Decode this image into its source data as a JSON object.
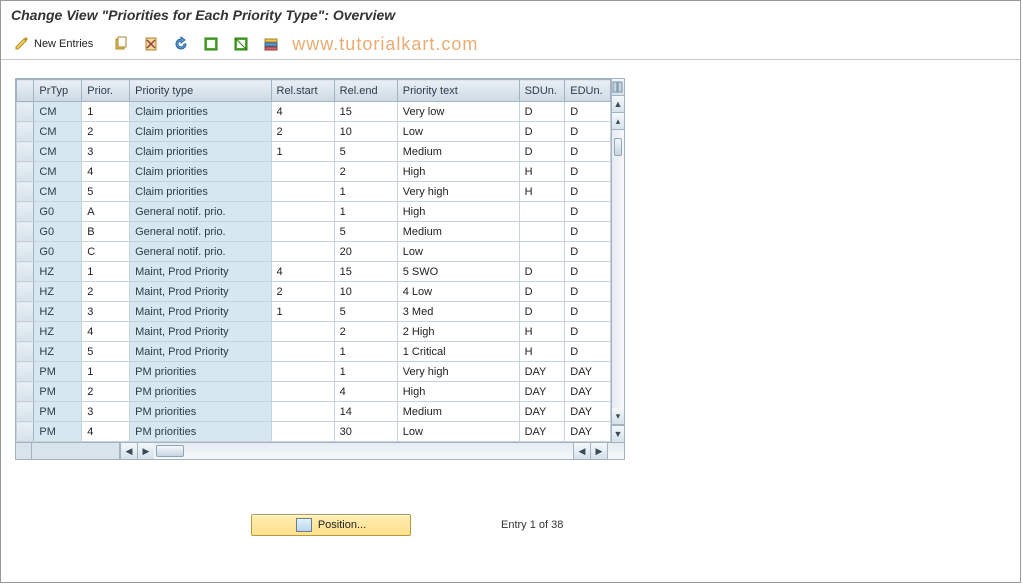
{
  "title": "Change View \"Priorities for Each Priority Type\": Overview",
  "watermark": "www.tutorialkart.com",
  "toolbar": {
    "new_entries_label": "New Entries"
  },
  "columns": {
    "prtyp": "PrTyp",
    "prior": "Prior.",
    "ptype": "Priority type",
    "start": "Rel.start",
    "end": "Rel.end",
    "ptext": "Priority text",
    "sd": "SDUn.",
    "ed": "EDUn."
  },
  "rows": [
    {
      "prtyp": "CM",
      "prior": "1",
      "ptype": "Claim priorities",
      "start": "4",
      "end": "15",
      "ptext": "Very low",
      "sd": "D",
      "ed": "D"
    },
    {
      "prtyp": "CM",
      "prior": "2",
      "ptype": "Claim priorities",
      "start": "2",
      "end": "10",
      "ptext": "Low",
      "sd": "D",
      "ed": "D"
    },
    {
      "prtyp": "CM",
      "prior": "3",
      "ptype": "Claim priorities",
      "start": "1",
      "end": "5",
      "ptext": "Medium",
      "sd": "D",
      "ed": "D"
    },
    {
      "prtyp": "CM",
      "prior": "4",
      "ptype": "Claim priorities",
      "start": "",
      "end": "2",
      "ptext": "High",
      "sd": "H",
      "ed": "D"
    },
    {
      "prtyp": "CM",
      "prior": "5",
      "ptype": "Claim priorities",
      "start": "",
      "end": "1",
      "ptext": "Very high",
      "sd": "H",
      "ed": "D"
    },
    {
      "prtyp": "G0",
      "prior": "A",
      "ptype": "General notif. prio.",
      "start": "",
      "end": "1",
      "ptext": "High",
      "sd": "",
      "ed": "D"
    },
    {
      "prtyp": "G0",
      "prior": "B",
      "ptype": "General notif. prio.",
      "start": "",
      "end": "5",
      "ptext": "Medium",
      "sd": "",
      "ed": "D"
    },
    {
      "prtyp": "G0",
      "prior": "C",
      "ptype": "General notif. prio.",
      "start": "",
      "end": "20",
      "ptext": "Low",
      "sd": "",
      "ed": "D"
    },
    {
      "prtyp": "HZ",
      "prior": "1",
      "ptype": "Maint, Prod Priority",
      "start": "4",
      "end": "15",
      "ptext": "5 SWO",
      "sd": "D",
      "ed": "D"
    },
    {
      "prtyp": "HZ",
      "prior": "2",
      "ptype": "Maint, Prod Priority",
      "start": "2",
      "end": "10",
      "ptext": "4 Low",
      "sd": "D",
      "ed": "D"
    },
    {
      "prtyp": "HZ",
      "prior": "3",
      "ptype": "Maint, Prod Priority",
      "start": "1",
      "end": "5",
      "ptext": "3 Med",
      "sd": "D",
      "ed": "D"
    },
    {
      "prtyp": "HZ",
      "prior": "4",
      "ptype": "Maint, Prod Priority",
      "start": "",
      "end": "2",
      "ptext": "2 High",
      "sd": "H",
      "ed": "D"
    },
    {
      "prtyp": "HZ",
      "prior": "5",
      "ptype": "Maint, Prod Priority",
      "start": "",
      "end": "1",
      "ptext": "1 Critical",
      "sd": "H",
      "ed": "D"
    },
    {
      "prtyp": "PM",
      "prior": "1",
      "ptype": "PM priorities",
      "start": "",
      "end": "1",
      "ptext": "Very high",
      "sd": "DAY",
      "ed": "DAY"
    },
    {
      "prtyp": "PM",
      "prior": "2",
      "ptype": "PM priorities",
      "start": "",
      "end": "4",
      "ptext": "High",
      "sd": "DAY",
      "ed": "DAY"
    },
    {
      "prtyp": "PM",
      "prior": "3",
      "ptype": "PM priorities",
      "start": "",
      "end": "14",
      "ptext": "Medium",
      "sd": "DAY",
      "ed": "DAY"
    },
    {
      "prtyp": "PM",
      "prior": "4",
      "ptype": "PM priorities",
      "start": "",
      "end": "30",
      "ptext": "Low",
      "sd": "DAY",
      "ed": "DAY"
    }
  ],
  "footer": {
    "position_label": "Position...",
    "status": "Entry 1 of 38"
  },
  "chart_data": {
    "type": "table",
    "title": "Priorities for Each Priority Type",
    "columns": [
      "PrTyp",
      "Prior.",
      "Priority type",
      "Rel.start",
      "Rel.end",
      "Priority text",
      "SDUn.",
      "EDUn."
    ],
    "rows": [
      [
        "CM",
        "1",
        "Claim priorities",
        "4",
        "15",
        "Very low",
        "D",
        "D"
      ],
      [
        "CM",
        "2",
        "Claim priorities",
        "2",
        "10",
        "Low",
        "D",
        "D"
      ],
      [
        "CM",
        "3",
        "Claim priorities",
        "1",
        "5",
        "Medium",
        "D",
        "D"
      ],
      [
        "CM",
        "4",
        "Claim priorities",
        "",
        "2",
        "High",
        "H",
        "D"
      ],
      [
        "CM",
        "5",
        "Claim priorities",
        "",
        "1",
        "Very high",
        "H",
        "D"
      ],
      [
        "G0",
        "A",
        "General notif. prio.",
        "",
        "1",
        "High",
        "",
        "D"
      ],
      [
        "G0",
        "B",
        "General notif. prio.",
        "",
        "5",
        "Medium",
        "",
        "D"
      ],
      [
        "G0",
        "C",
        "General notif. prio.",
        "",
        "20",
        "Low",
        "",
        "D"
      ],
      [
        "HZ",
        "1",
        "Maint, Prod Priority",
        "4",
        "15",
        "5 SWO",
        "D",
        "D"
      ],
      [
        "HZ",
        "2",
        "Maint, Prod Priority",
        "2",
        "10",
        "4 Low",
        "D",
        "D"
      ],
      [
        "HZ",
        "3",
        "Maint, Prod Priority",
        "1",
        "5",
        "3 Med",
        "D",
        "D"
      ],
      [
        "HZ",
        "4",
        "Maint, Prod Priority",
        "",
        "2",
        "2 High",
        "H",
        "D"
      ],
      [
        "HZ",
        "5",
        "Maint, Prod Priority",
        "",
        "1",
        "1 Critical",
        "H",
        "D"
      ],
      [
        "PM",
        "1",
        "PM priorities",
        "",
        "1",
        "Very high",
        "DAY",
        "DAY"
      ],
      [
        "PM",
        "2",
        "PM priorities",
        "",
        "4",
        "High",
        "DAY",
        "DAY"
      ],
      [
        "PM",
        "3",
        "PM priorities",
        "",
        "14",
        "Medium",
        "DAY",
        "DAY"
      ],
      [
        "PM",
        "4",
        "PM priorities",
        "",
        "30",
        "Low",
        "DAY",
        "DAY"
      ]
    ]
  }
}
